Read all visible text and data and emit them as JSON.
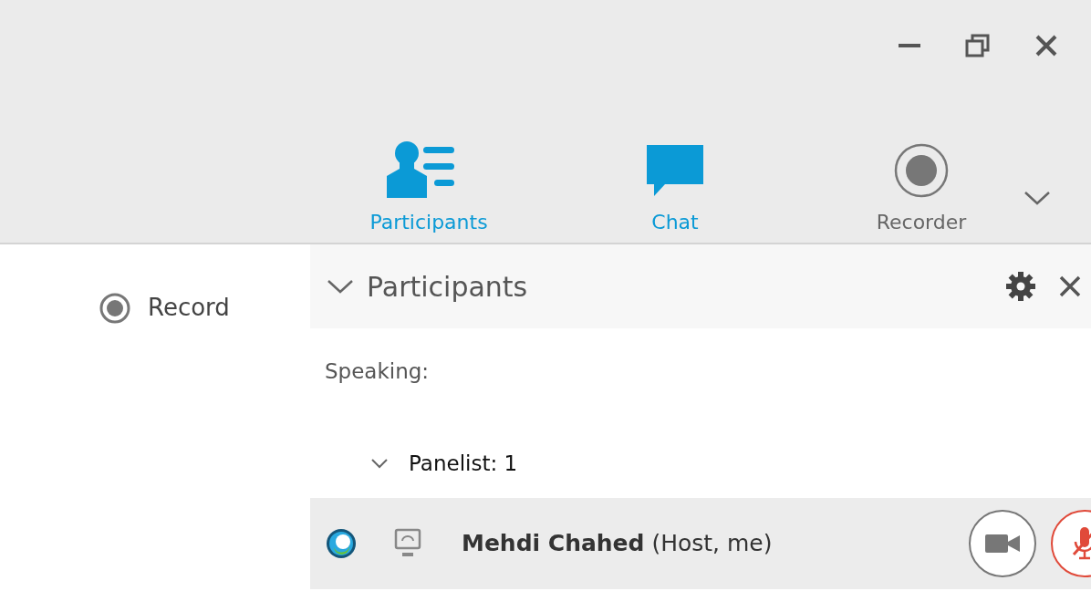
{
  "window": {
    "controls": [
      {
        "kind": "minimize"
      },
      {
        "kind": "restore"
      },
      {
        "kind": "close"
      }
    ]
  },
  "tabs": [
    {
      "kind": "participants",
      "label": "Participants",
      "active": true
    },
    {
      "kind": "chat",
      "label": "Chat",
      "active": true
    },
    {
      "kind": "recorder",
      "label": "Recorder",
      "active": false
    }
  ],
  "record": {
    "label": "Record"
  },
  "panel": {
    "title": "Participants",
    "expanded": true,
    "speaking_label": "Speaking:",
    "groups": [
      {
        "label": "Panelist: 1",
        "expanded": true,
        "members": [
          {
            "name": "Mehdi Chahed",
            "role": "(Host, me)",
            "muted": true
          }
        ]
      }
    ]
  }
}
